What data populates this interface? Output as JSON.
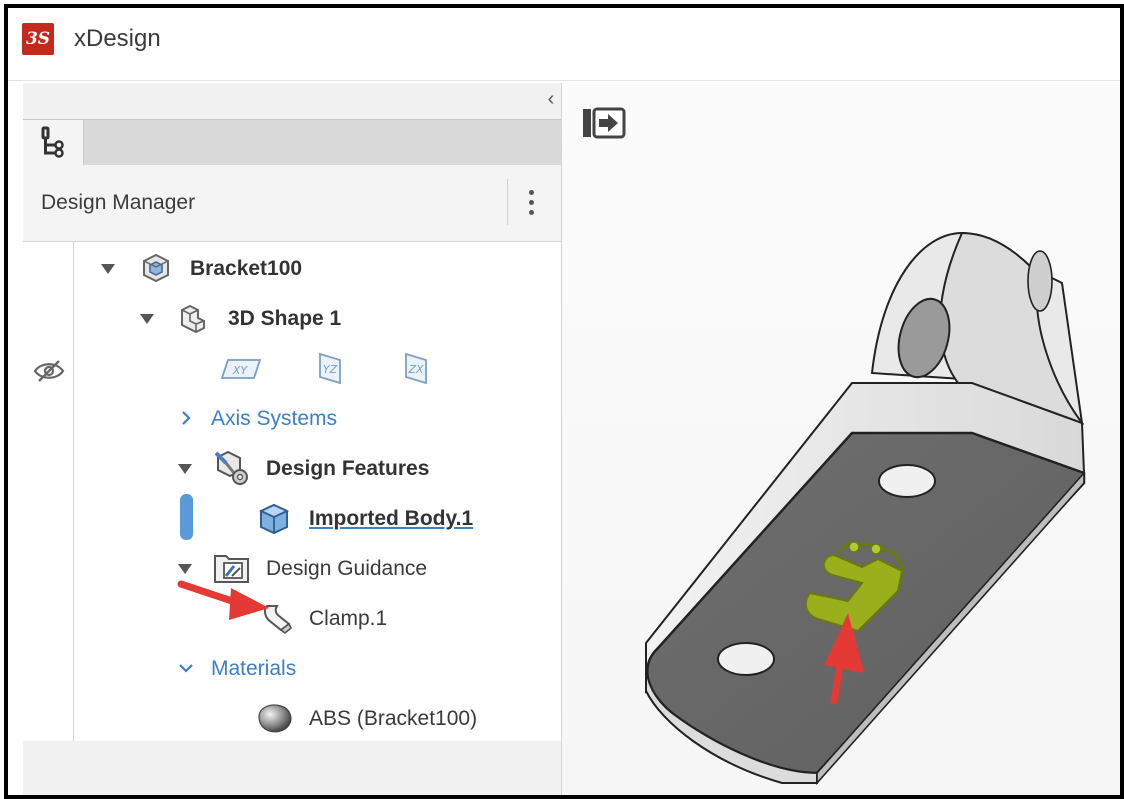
{
  "app": {
    "title": "xDesign",
    "logo_text": "3S"
  },
  "panel": {
    "header_title": "Design Manager",
    "collapse_glyph": "‹"
  },
  "tree": {
    "root": {
      "label": "Bracket100"
    },
    "shape": {
      "label": "3D Shape 1"
    },
    "planes": [
      "XY",
      "YZ",
      "ZX"
    ],
    "axis_systems": {
      "label": "Axis Systems"
    },
    "design_features": {
      "label": "Design Features"
    },
    "imported_body": {
      "label": "Imported Body.1"
    },
    "design_guidance": {
      "label": "Design Guidance"
    },
    "clamp": {
      "label": "Clamp.1"
    },
    "materials": {
      "label": "Materials"
    },
    "material_item": {
      "label": "ABS (Bracket100)"
    }
  },
  "icons": {
    "visibility": "eye-slash-icon",
    "tab": "tree-icon",
    "menu": "kebab-icon"
  },
  "colors": {
    "logo_red": "#c5281c",
    "link_blue": "#3d7fc4",
    "annotation_red": "#e53935",
    "part_highlight": "#9aaf1c"
  }
}
